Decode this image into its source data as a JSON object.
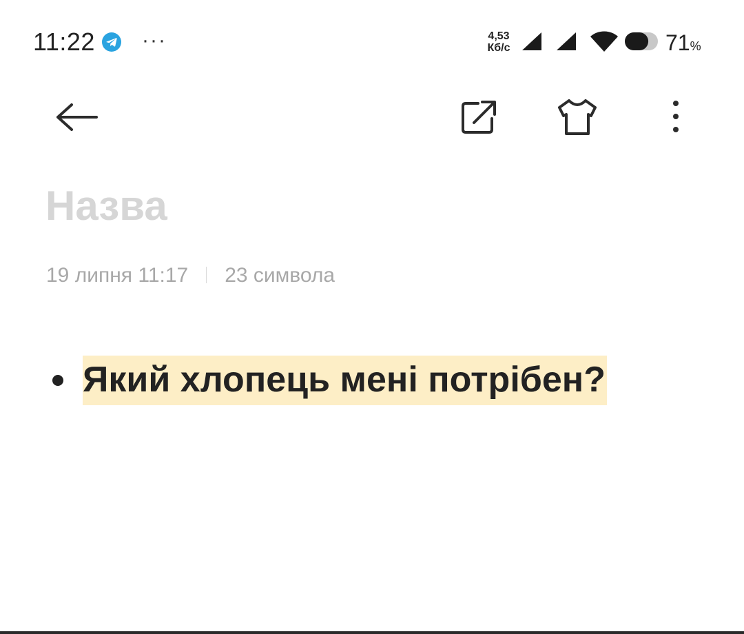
{
  "status_bar": {
    "time": "11:22",
    "overflow": "···",
    "net_speed_value": "4,53",
    "net_speed_unit": "Кб/с",
    "battery_percent": "71",
    "battery_sign": "%",
    "battery_level": 0.71,
    "icons": [
      "telegram-icon",
      "signal-icon",
      "signal-icon",
      "wifi-icon",
      "battery-icon"
    ],
    "telegram_color": "#2aa3e0"
  },
  "toolbar": {
    "icons": [
      "back-arrow-icon",
      "share-icon",
      "theme-icon",
      "more-vertical-icon"
    ]
  },
  "note": {
    "title_placeholder": "Назва",
    "date": "19 липня 11:17",
    "char_count": "23 символа",
    "items": [
      {
        "text": "Який хлопець мені потрібен?",
        "highlight": "#fdeec6"
      }
    ]
  }
}
